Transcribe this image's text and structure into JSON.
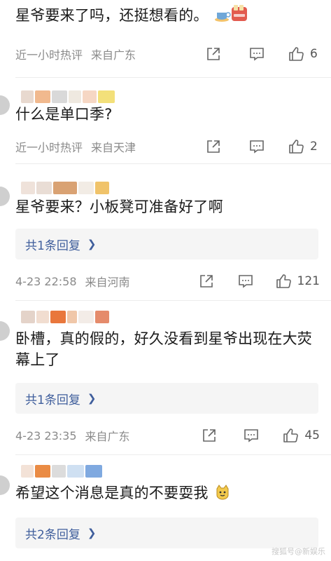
{
  "comments": [
    {
      "text": "星爷要来了吗，还挺想看的。",
      "time": "近一小时热评",
      "location": "来自广东",
      "likes": "6"
    },
    {
      "text": "什么是单口季?",
      "time": "近一小时热评",
      "location": "来自天津",
      "likes": "2"
    },
    {
      "text": "星爷要来？小板凳可准备好了啊",
      "replies": "共1条回复",
      "time": "4-23 22:58",
      "location": "来自河南",
      "likes": "121"
    },
    {
      "text": "卧槽，真的假的，好久没看到星爷出现在大荧幕上了",
      "replies": "共1条回复",
      "time": "4-23 23:35",
      "location": "来自广东",
      "likes": "45"
    },
    {
      "text": "希望这个消息是真的不要耍我",
      "replies": "共2条回复"
    }
  ],
  "icons": [
    "share-icon",
    "comment-icon",
    "like-icon",
    "chevron-right-icon"
  ],
  "colors": {
    "link": "#3f5e9c",
    "meta": "#8a8a8a",
    "reply_bg": "#f5f5f5"
  },
  "watermark": "搜狐号@新娱乐"
}
